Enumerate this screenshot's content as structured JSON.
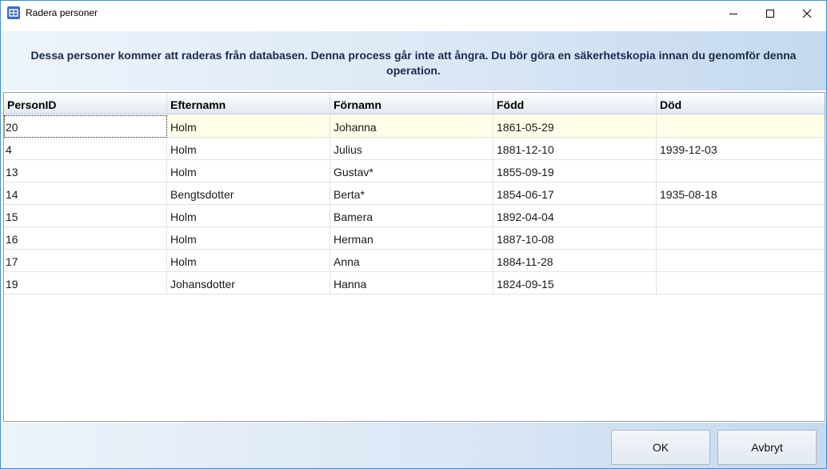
{
  "window": {
    "title": "Radera personer"
  },
  "banner": {
    "message": "Dessa personer kommer att raderas från databasen. Denna process går inte att ångra. Du bör göra en säkerhetskopia innan du genomför denna operation."
  },
  "table": {
    "columns": [
      "PersonID",
      "Efternamn",
      "Förnamn",
      "Född",
      "Död"
    ],
    "rows": [
      [
        "20",
        "Holm",
        "Johanna",
        "1861-05-29",
        ""
      ],
      [
        "4",
        "Holm",
        "Julius",
        "1881-12-10",
        "1939-12-03"
      ],
      [
        "13",
        "Holm",
        "Gustav*",
        "1855-09-19",
        ""
      ],
      [
        "14",
        "Bengtsdotter",
        "Berta*",
        "1854-06-17",
        "1935-08-18"
      ],
      [
        "15",
        "Holm",
        "Bamera",
        "1892-04-04",
        ""
      ],
      [
        "16",
        "Holm",
        "Herman",
        "1887-10-08",
        ""
      ],
      [
        "17",
        "Holm",
        "Anna",
        "1884-11-28",
        ""
      ],
      [
        "19",
        "Johansdotter",
        "Hanna",
        "1824-09-15",
        ""
      ]
    ]
  },
  "buttons": {
    "ok": "OK",
    "cancel": "Avbryt"
  },
  "icons": {
    "app": "app-icon",
    "minimize": "minimize-icon",
    "maximize": "maximize-icon",
    "close": "close-icon"
  },
  "colors": {
    "accent_border": "#3c8fd6",
    "selected_row": "#fefde7",
    "banner_text": "#1b2a4a"
  }
}
